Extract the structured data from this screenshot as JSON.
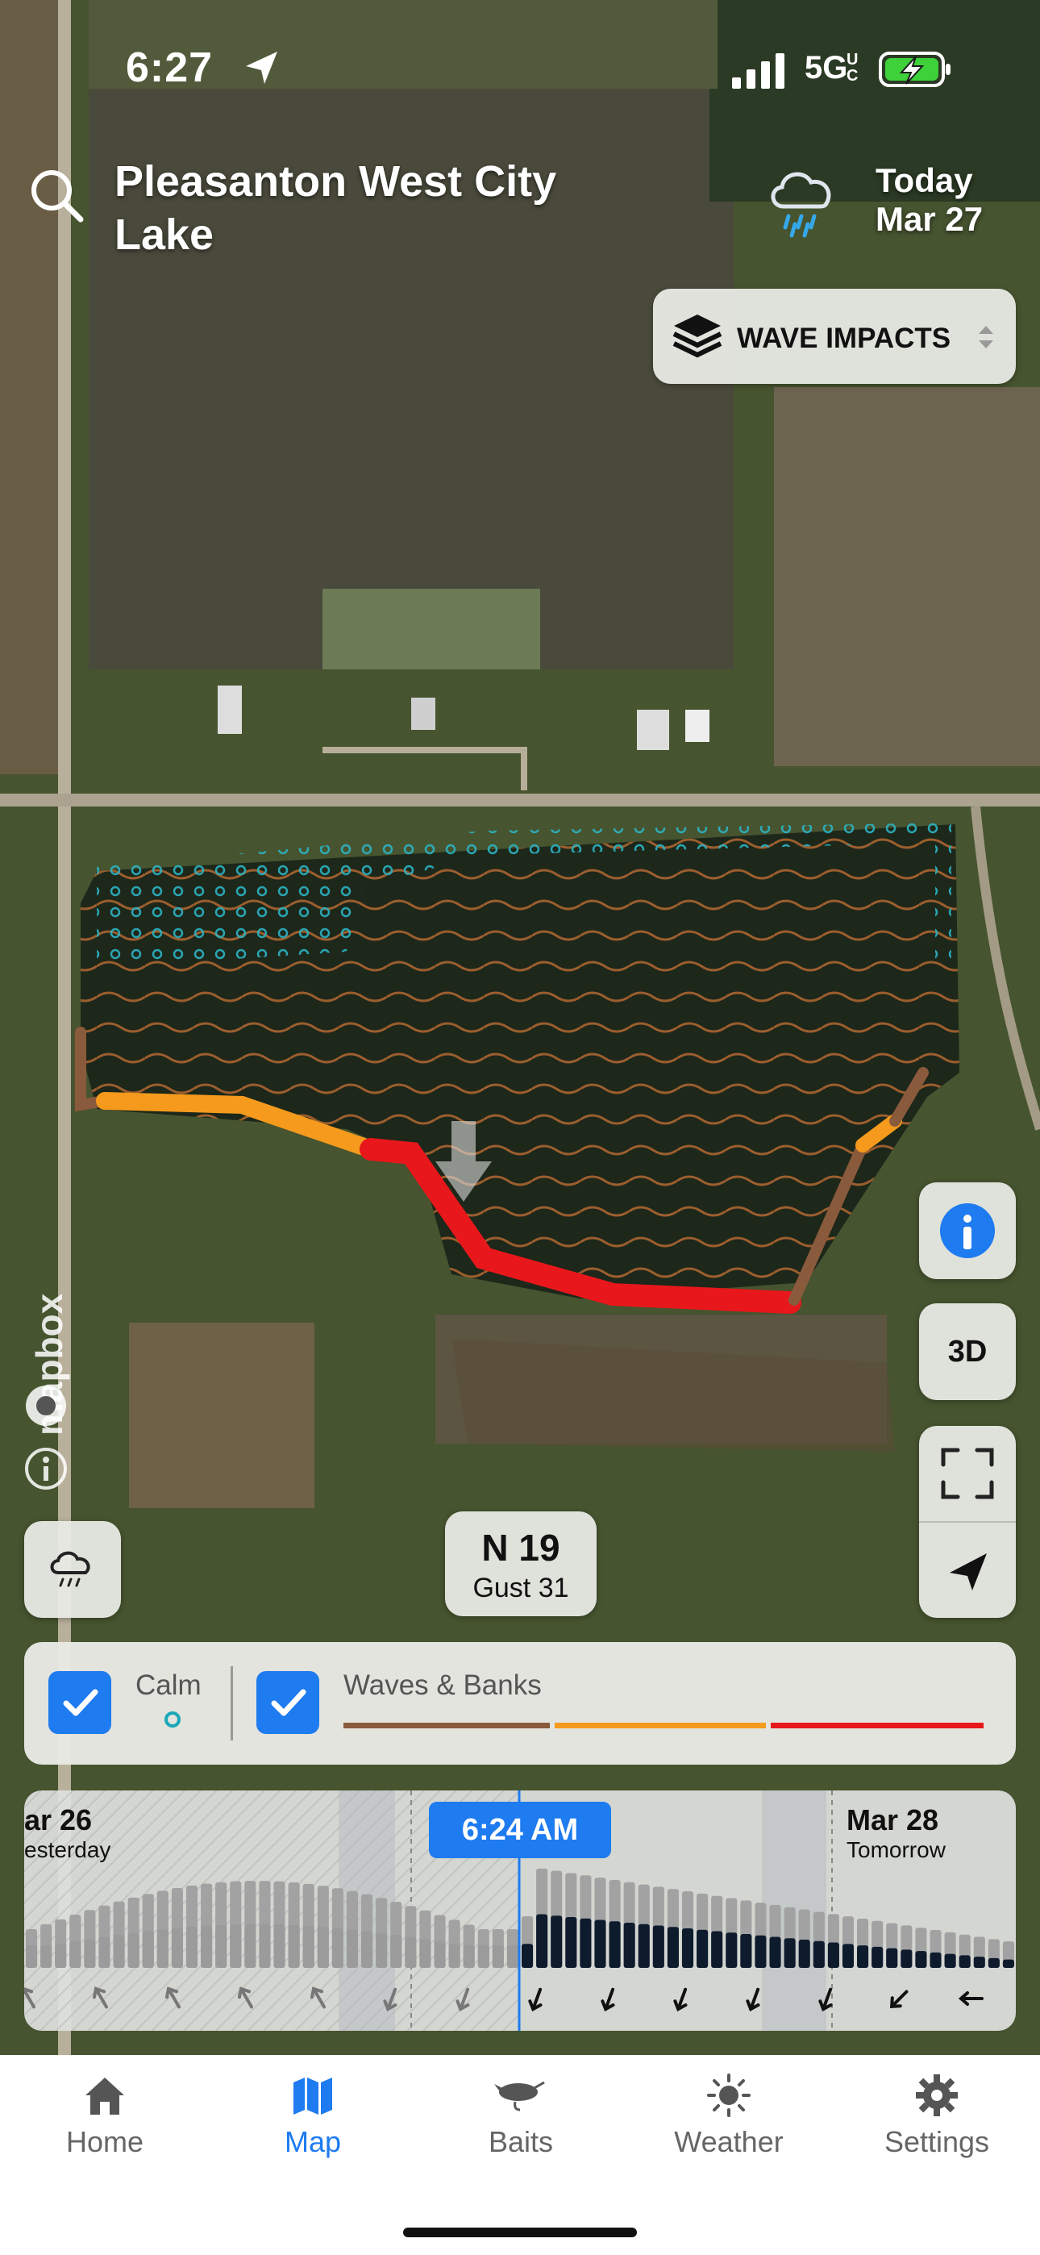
{
  "status_bar": {
    "time": "6:27",
    "network": "5G",
    "network_suffix": "UC"
  },
  "header": {
    "lake_name": "Pleasanton West City Lake",
    "weather_icon": "rain-cloud-icon",
    "date_line1": "Today",
    "date_line2": "Mar 27"
  },
  "layer_selector": {
    "label": "WAVE IMPACTS",
    "icon": "layers-icon"
  },
  "map_controls": {
    "info": "info-icon",
    "three_d": "3D",
    "fullscreen": "fullscreen-icon",
    "locate": "location-arrow-icon",
    "weather_toggle": "rain-cloud-icon"
  },
  "map_attribution": {
    "logo": "mapbox"
  },
  "wind": {
    "direction_speed": "N 19",
    "gust": "Gust 31"
  },
  "legend": {
    "calm_label": "Calm",
    "waves_label": "Waves & Banks",
    "calm_checked": true,
    "waves_checked": true,
    "wave_colors": [
      "#8a5a3c",
      "#f59a1c",
      "#e8171b"
    ]
  },
  "timeline": {
    "left_day": "ar 26",
    "left_sub": "esterday",
    "current_time": "6:24 AM",
    "right_day": "Mar 28",
    "right_sub": "Tomorrow"
  },
  "tabs": [
    {
      "label": "Home",
      "icon": "house-icon",
      "active": false
    },
    {
      "label": "Map",
      "icon": "map-icon",
      "active": true
    },
    {
      "label": "Baits",
      "icon": "lure-icon",
      "active": false
    },
    {
      "label": "Weather",
      "icon": "sun-icon",
      "active": false
    },
    {
      "label": "Settings",
      "icon": "gear-icon",
      "active": false
    }
  ],
  "colors": {
    "accent": "#1e7bf0",
    "calm_dot": "#1aa8b8",
    "wave_line": "#a9682f"
  }
}
